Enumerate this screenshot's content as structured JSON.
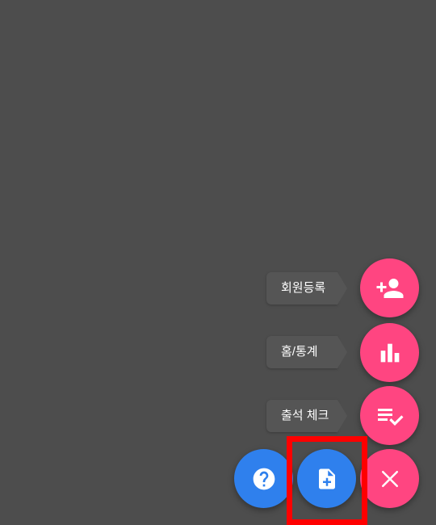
{
  "speed_dial": {
    "actions": [
      {
        "label": "회원등록",
        "icon": "person-add-icon"
      },
      {
        "label": "홈/통계",
        "icon": "bar-chart-icon"
      },
      {
        "label": "출석 체크",
        "icon": "playlist-check-icon"
      }
    ],
    "close_icon": "close-icon"
  },
  "bottom_buttons": {
    "help_icon": "help-circle-icon",
    "new_document_icon": "note-add-icon"
  },
  "colors": {
    "background": "#4d4d4d",
    "accent_pink": "#ff4581",
    "accent_blue": "#2f80ed",
    "chip_background": "#555555",
    "highlight": "#ff0000"
  }
}
